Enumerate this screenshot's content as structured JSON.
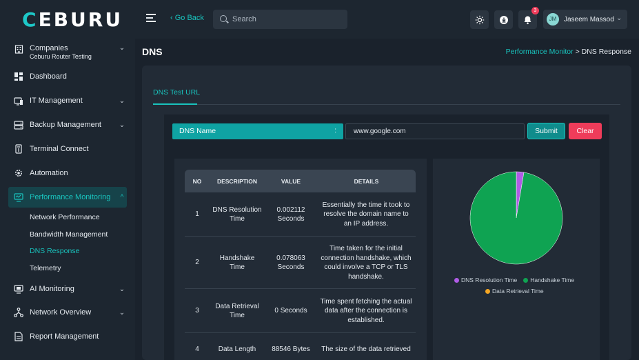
{
  "brand": {
    "logo_a": "C",
    "logo_b": "EBURU"
  },
  "topbar": {
    "go_back": "‹ Go Back",
    "search_placeholder": "Search",
    "notification_count": "3",
    "user_initials": "JM",
    "user_name": "Jaseem Massod"
  },
  "sidebar": {
    "companies": {
      "label": "Companies",
      "sub": "Ceburu Router Testing"
    },
    "items": [
      {
        "label": "Dashboard"
      },
      {
        "label": "IT Management"
      },
      {
        "label": "Backup Management"
      },
      {
        "label": "Terminal Connect"
      },
      {
        "label": "Automation"
      },
      {
        "label": "Performance Monitoring"
      },
      {
        "label": "AI Monitoring"
      },
      {
        "label": "Network Overview"
      },
      {
        "label": "Report Management"
      }
    ],
    "performance_sub": [
      "Network Performance",
      "Bandwidth Management",
      "DNS Response",
      "Telemetry"
    ]
  },
  "page": {
    "title": "DNS",
    "breadcrumb_parent": "Performance Monitor",
    "breadcrumb_sep": ">",
    "breadcrumb_current": "DNS Response",
    "tab": "DNS Test URL"
  },
  "form": {
    "dns_label": "DNS Name",
    "dns_sep": ":",
    "url_value": "www.google.com",
    "submit": "Submit",
    "clear": "Clear"
  },
  "table": {
    "headers": [
      "NO",
      "DESCRIPTION",
      "VALUE",
      "DETAILS"
    ],
    "rows": [
      {
        "no": "1",
        "description": "DNS Resolution Time",
        "value": "0.002112 Seconds",
        "details": "Essentially the time it took to resolve the domain name to an IP address."
      },
      {
        "no": "2",
        "description": "Handshake Time",
        "value": "0.078063 Seconds",
        "details": "Time taken for the initial connection handshake, which could involve a TCP or TLS handshake."
      },
      {
        "no": "3",
        "description": "Data Retrieval Time",
        "value": "0 Seconds",
        "details": "Time spent fetching the actual data after the connection is established."
      },
      {
        "no": "4",
        "description": "Data Length",
        "value": "88546 Bytes",
        "details": "The size of the data retrieved"
      }
    ]
  },
  "chart_data": {
    "type": "pie",
    "series": [
      {
        "name": "DNS Resolution Time",
        "value": 0.002112,
        "color": "#b05ce6"
      },
      {
        "name": "Handshake Time",
        "value": 0.078063,
        "color": "#0fa352"
      },
      {
        "name": "Data Retrieval Time",
        "value": 0,
        "color": "#f5a623"
      }
    ],
    "legend_position": "bottom"
  },
  "colors": {
    "accent": "#19c3bd",
    "danger": "#ef3c5a",
    "panel": "#222b36"
  }
}
